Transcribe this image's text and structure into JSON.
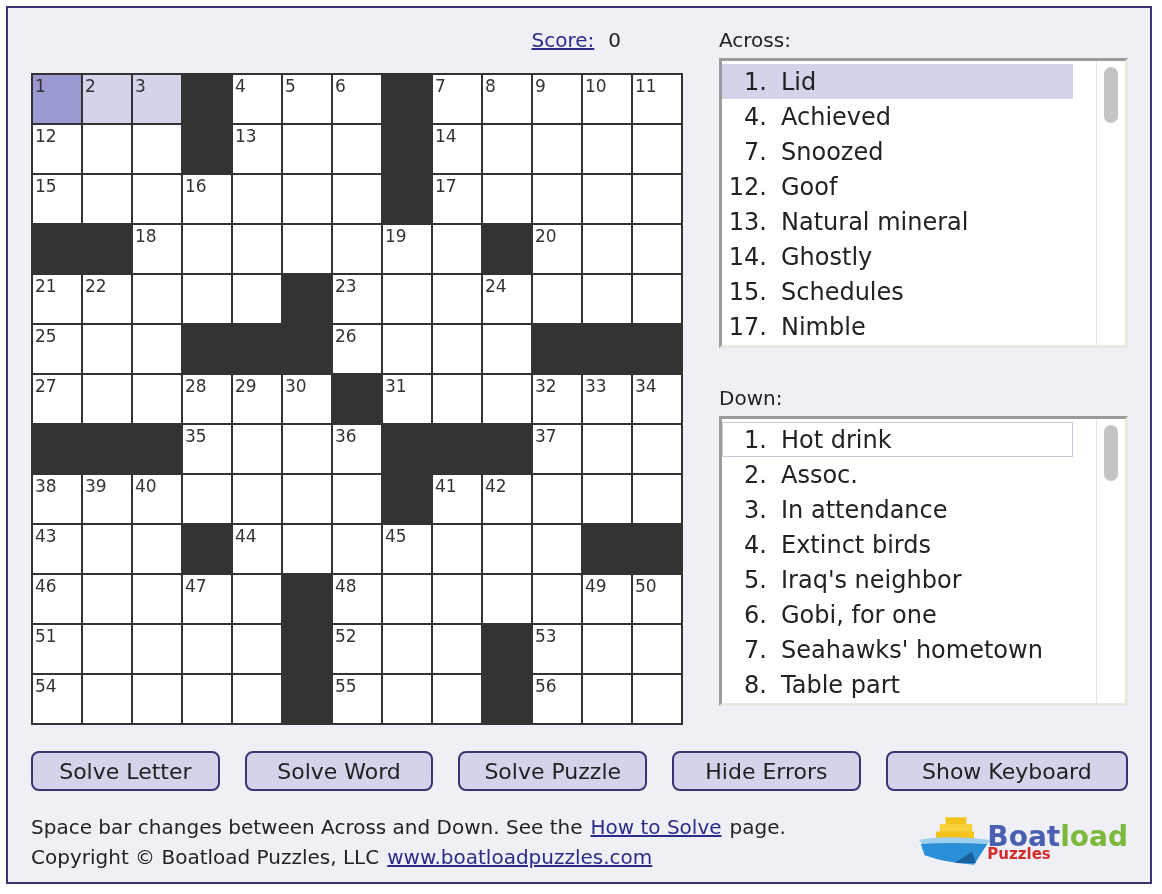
{
  "score": {
    "label": "Score:",
    "value": "0"
  },
  "grid": [
    [
      {
        "kind": "cursor",
        "number": "1"
      },
      {
        "kind": "word",
        "number": "2"
      },
      {
        "kind": "word",
        "number": "3"
      },
      {
        "kind": "block"
      },
      {
        "kind": "white",
        "number": "4"
      },
      {
        "kind": "white",
        "number": "5"
      },
      {
        "kind": "white",
        "number": "6"
      },
      {
        "kind": "block"
      },
      {
        "kind": "white",
        "number": "7"
      },
      {
        "kind": "white",
        "number": "8"
      },
      {
        "kind": "white",
        "number": "9"
      },
      {
        "kind": "white",
        "number": "10"
      },
      {
        "kind": "white",
        "number": "11"
      }
    ],
    [
      {
        "kind": "white",
        "number": "12"
      },
      {
        "kind": "white"
      },
      {
        "kind": "white"
      },
      {
        "kind": "block"
      },
      {
        "kind": "white",
        "number": "13"
      },
      {
        "kind": "white"
      },
      {
        "kind": "white"
      },
      {
        "kind": "block"
      },
      {
        "kind": "white",
        "number": "14"
      },
      {
        "kind": "white"
      },
      {
        "kind": "white"
      },
      {
        "kind": "white"
      },
      {
        "kind": "white"
      }
    ],
    [
      {
        "kind": "white",
        "number": "15"
      },
      {
        "kind": "white"
      },
      {
        "kind": "white"
      },
      {
        "kind": "white",
        "number": "16"
      },
      {
        "kind": "white"
      },
      {
        "kind": "white"
      },
      {
        "kind": "white"
      },
      {
        "kind": "block"
      },
      {
        "kind": "white",
        "number": "17"
      },
      {
        "kind": "white"
      },
      {
        "kind": "white"
      },
      {
        "kind": "white"
      },
      {
        "kind": "white"
      }
    ],
    [
      {
        "kind": "block"
      },
      {
        "kind": "block"
      },
      {
        "kind": "white",
        "number": "18"
      },
      {
        "kind": "white"
      },
      {
        "kind": "white"
      },
      {
        "kind": "white"
      },
      {
        "kind": "white"
      },
      {
        "kind": "white",
        "number": "19"
      },
      {
        "kind": "white"
      },
      {
        "kind": "block"
      },
      {
        "kind": "white",
        "number": "20"
      },
      {
        "kind": "white"
      },
      {
        "kind": "white"
      }
    ],
    [
      {
        "kind": "white",
        "number": "21"
      },
      {
        "kind": "white",
        "number": "22"
      },
      {
        "kind": "white"
      },
      {
        "kind": "white"
      },
      {
        "kind": "white"
      },
      {
        "kind": "block"
      },
      {
        "kind": "white",
        "number": "23"
      },
      {
        "kind": "white"
      },
      {
        "kind": "white"
      },
      {
        "kind": "white",
        "number": "24"
      },
      {
        "kind": "white"
      },
      {
        "kind": "white"
      },
      {
        "kind": "white"
      }
    ],
    [
      {
        "kind": "white",
        "number": "25"
      },
      {
        "kind": "white"
      },
      {
        "kind": "white"
      },
      {
        "kind": "block"
      },
      {
        "kind": "block"
      },
      {
        "kind": "block"
      },
      {
        "kind": "white",
        "number": "26"
      },
      {
        "kind": "white"
      },
      {
        "kind": "white"
      },
      {
        "kind": "white"
      },
      {
        "kind": "block"
      },
      {
        "kind": "block"
      },
      {
        "kind": "block"
      }
    ],
    [
      {
        "kind": "white",
        "number": "27"
      },
      {
        "kind": "white"
      },
      {
        "kind": "white"
      },
      {
        "kind": "white",
        "number": "28"
      },
      {
        "kind": "white",
        "number": "29"
      },
      {
        "kind": "white",
        "number": "30"
      },
      {
        "kind": "block"
      },
      {
        "kind": "white",
        "number": "31"
      },
      {
        "kind": "white"
      },
      {
        "kind": "white"
      },
      {
        "kind": "white",
        "number": "32"
      },
      {
        "kind": "white",
        "number": "33"
      },
      {
        "kind": "white",
        "number": "34"
      }
    ],
    [
      {
        "kind": "block"
      },
      {
        "kind": "block"
      },
      {
        "kind": "block"
      },
      {
        "kind": "white",
        "number": "35"
      },
      {
        "kind": "white"
      },
      {
        "kind": "white"
      },
      {
        "kind": "white",
        "number": "36"
      },
      {
        "kind": "block"
      },
      {
        "kind": "block"
      },
      {
        "kind": "block"
      },
      {
        "kind": "white",
        "number": "37"
      },
      {
        "kind": "white"
      },
      {
        "kind": "white"
      }
    ],
    [
      {
        "kind": "white",
        "number": "38"
      },
      {
        "kind": "white",
        "number": "39"
      },
      {
        "kind": "white",
        "number": "40"
      },
      {
        "kind": "white"
      },
      {
        "kind": "white"
      },
      {
        "kind": "white"
      },
      {
        "kind": "white"
      },
      {
        "kind": "block"
      },
      {
        "kind": "white",
        "number": "41"
      },
      {
        "kind": "white",
        "number": "42"
      },
      {
        "kind": "white"
      },
      {
        "kind": "white"
      },
      {
        "kind": "white"
      }
    ],
    [
      {
        "kind": "white",
        "number": "43"
      },
      {
        "kind": "white"
      },
      {
        "kind": "white"
      },
      {
        "kind": "block"
      },
      {
        "kind": "white",
        "number": "44"
      },
      {
        "kind": "white"
      },
      {
        "kind": "white"
      },
      {
        "kind": "white",
        "number": "45"
      },
      {
        "kind": "white"
      },
      {
        "kind": "white"
      },
      {
        "kind": "white"
      },
      {
        "kind": "block"
      },
      {
        "kind": "block"
      }
    ],
    [
      {
        "kind": "white",
        "number": "46"
      },
      {
        "kind": "white"
      },
      {
        "kind": "white"
      },
      {
        "kind": "white",
        "number": "47"
      },
      {
        "kind": "white"
      },
      {
        "kind": "block"
      },
      {
        "kind": "white",
        "number": "48"
      },
      {
        "kind": "white"
      },
      {
        "kind": "white"
      },
      {
        "kind": "white"
      },
      {
        "kind": "white"
      },
      {
        "kind": "white",
        "number": "49"
      },
      {
        "kind": "white",
        "number": "50"
      }
    ],
    [
      {
        "kind": "white",
        "number": "51"
      },
      {
        "kind": "white"
      },
      {
        "kind": "white"
      },
      {
        "kind": "white"
      },
      {
        "kind": "white"
      },
      {
        "kind": "block"
      },
      {
        "kind": "white",
        "number": "52"
      },
      {
        "kind": "white"
      },
      {
        "kind": "white"
      },
      {
        "kind": "block"
      },
      {
        "kind": "white",
        "number": "53"
      },
      {
        "kind": "white"
      },
      {
        "kind": "white"
      }
    ],
    [
      {
        "kind": "white",
        "number": "54"
      },
      {
        "kind": "white"
      },
      {
        "kind": "white"
      },
      {
        "kind": "white"
      },
      {
        "kind": "white"
      },
      {
        "kind": "block"
      },
      {
        "kind": "white",
        "number": "55"
      },
      {
        "kind": "white"
      },
      {
        "kind": "white"
      },
      {
        "kind": "block"
      },
      {
        "kind": "white",
        "number": "56"
      },
      {
        "kind": "white"
      },
      {
        "kind": "white"
      }
    ]
  ],
  "clue_lists": [
    {
      "title": "Across:",
      "active": true,
      "clues": [
        {
          "number": "1.",
          "text": "Lid",
          "selected": true
        },
        {
          "number": "4.",
          "text": "Achieved",
          "selected": false
        },
        {
          "number": "7.",
          "text": "Snoozed",
          "selected": false
        },
        {
          "number": "12.",
          "text": "Goof",
          "selected": false
        },
        {
          "number": "13.",
          "text": "Natural mineral",
          "selected": false
        },
        {
          "number": "14.",
          "text": "Ghostly",
          "selected": false
        },
        {
          "number": "15.",
          "text": "Schedules",
          "selected": false
        },
        {
          "number": "17.",
          "text": "Nimble",
          "selected": false
        }
      ]
    },
    {
      "title": "Down:",
      "active": false,
      "clues": [
        {
          "number": "1.",
          "text": "Hot drink",
          "selected": true
        },
        {
          "number": "2.",
          "text": "Assoc.",
          "selected": false
        },
        {
          "number": "3.",
          "text": "In attendance",
          "selected": false
        },
        {
          "number": "4.",
          "text": "Extinct birds",
          "selected": false
        },
        {
          "number": "5.",
          "text": "Iraq's neighbor",
          "selected": false
        },
        {
          "number": "6.",
          "text": "Gobi, for one",
          "selected": false
        },
        {
          "number": "7.",
          "text": "Seahawks' hometown",
          "selected": false
        },
        {
          "number": "8.",
          "text": "Table part",
          "selected": false
        }
      ]
    }
  ],
  "buttons": [
    "Solve Letter",
    "Solve Word",
    "Solve Puzzle",
    "Hide Errors",
    "Show Keyboard"
  ],
  "footer": {
    "line_1": {
      "text": "Space bar changes between Across and Down. See the",
      "link": "How to Solve",
      "after": "page."
    },
    "line_2": {
      "text": "Copyright © Boatload Puzzles, LLC",
      "link": "www.boatloadpuzzles.com"
    }
  },
  "logo": {
    "word_1": "Boat",
    "word_2": "load",
    "word_3": "Puzzles"
  }
}
